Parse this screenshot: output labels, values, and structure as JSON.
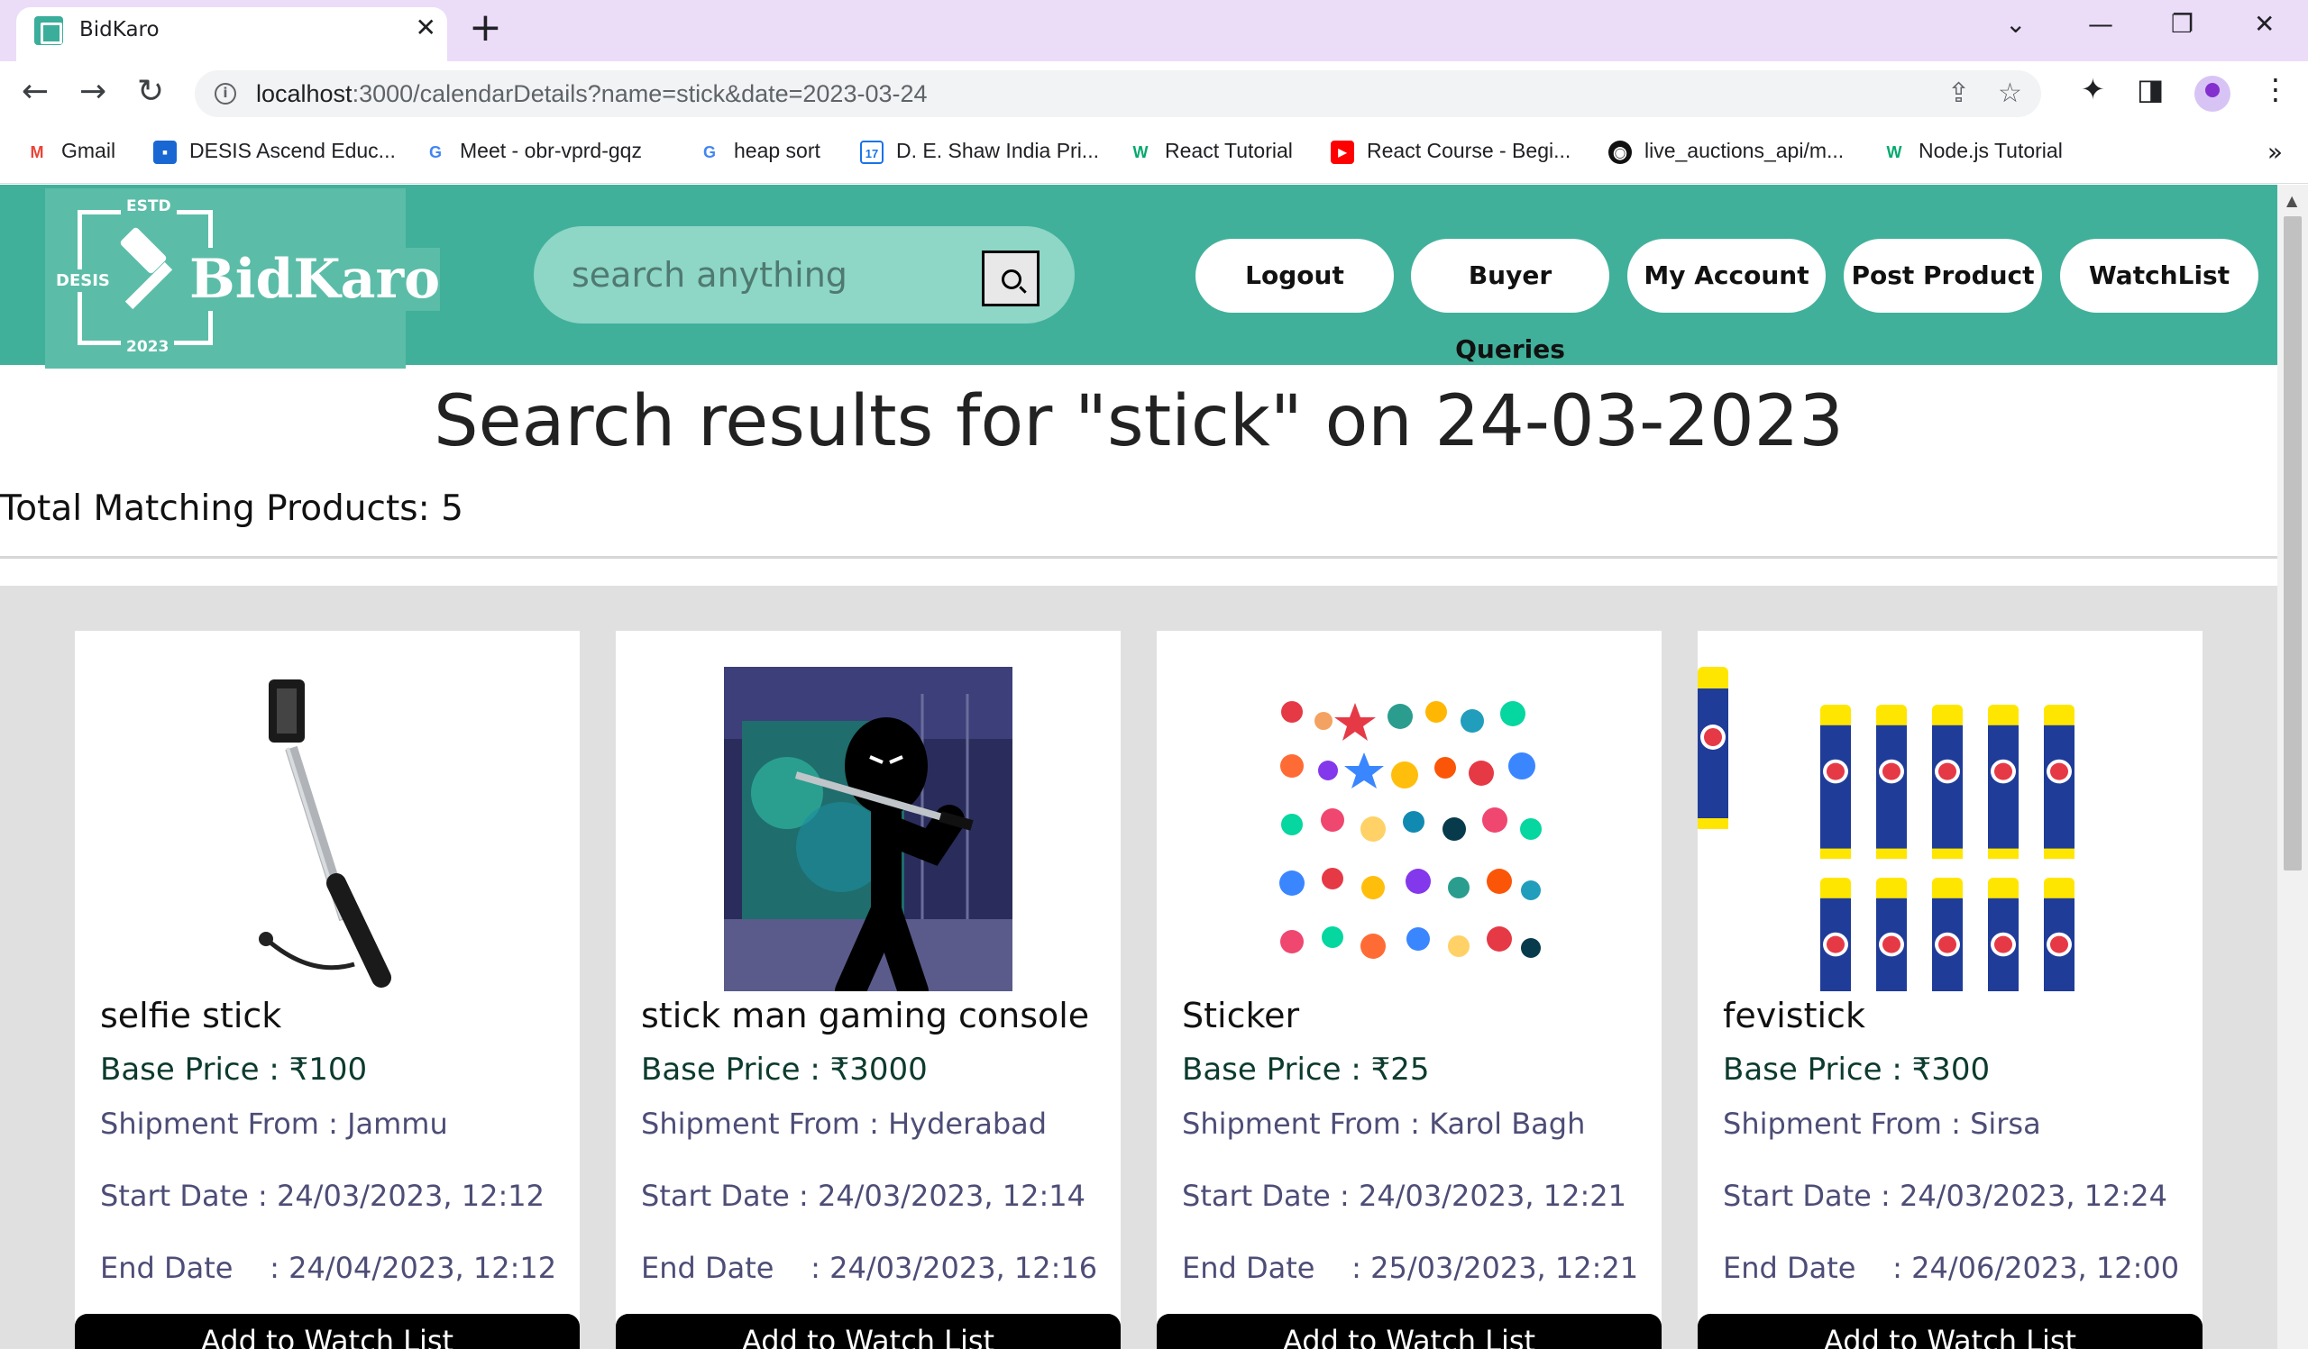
{
  "browser": {
    "tab_title": "BidKaro",
    "url_host": "localhost",
    "url_rest": ":3000/calendarDetails?name=stick&date=2023-03-24"
  },
  "bookmarks": [
    {
      "label": "Gmail",
      "icon": "gmail-icon"
    },
    {
      "label": "DESIS Ascend Educ...",
      "icon": "classroom-icon"
    },
    {
      "label": "Meet - obr-vprd-gqz",
      "icon": "google-icon"
    },
    {
      "label": "heap sort",
      "icon": "google-icon"
    },
    {
      "label": "D. E. Shaw India Pri...",
      "icon": "calendar-icon"
    },
    {
      "label": "React Tutorial",
      "icon": "w3schools-icon"
    },
    {
      "label": "React Course - Begi...",
      "icon": "youtube-icon"
    },
    {
      "label": "live_auctions_api/m...",
      "icon": "github-icon"
    },
    {
      "label": "Node.js Tutorial",
      "icon": "w3schools-icon"
    }
  ],
  "header": {
    "logo": {
      "estd": "ESTD",
      "desis": "DESIS",
      "name": "BidKaro",
      "year": "2023"
    },
    "search_placeholder": "search anything",
    "nav": [
      "Logout",
      "Buyer Queries",
      "My Account",
      "Post Product",
      "WatchList"
    ],
    "accent_color": "#41b09a"
  },
  "main": {
    "title": "Search results for \"stick\" on 24-03-2023",
    "total": "Total Matching Products: 5",
    "watch_button_label": "Add to Watch List",
    "products": [
      {
        "name": "selfie stick",
        "price": "Base Price : ₹100",
        "shipment": "Shipment From : Jammu",
        "start": "Start Date : 24/03/2023, 12:12",
        "end": "End Date    : 24/04/2023, 12:12",
        "image": "selfie-stick-image"
      },
      {
        "name": "stick man gaming console",
        "price": "Base Price : ₹3000",
        "shipment": "Shipment From : Hyderabad",
        "start": "Start Date : 24/03/2023, 12:14",
        "end": "End Date    : 24/03/2023, 12:16",
        "image": "stickman-image"
      },
      {
        "name": "Sticker",
        "price": "Base Price : ₹25",
        "shipment": "Shipment From : Karol Bagh",
        "start": "Start Date : 24/03/2023, 12:21",
        "end": "End Date    : 25/03/2023, 12:21",
        "image": "stickers-image"
      },
      {
        "name": "fevistick",
        "price": "Base Price : ₹300",
        "shipment": "Shipment From : Sirsa",
        "start": "Start Date : 24/03/2023, 12:24",
        "end": "End Date    : 24/06/2023, 12:00",
        "image": "glue-sticks-image"
      }
    ]
  }
}
